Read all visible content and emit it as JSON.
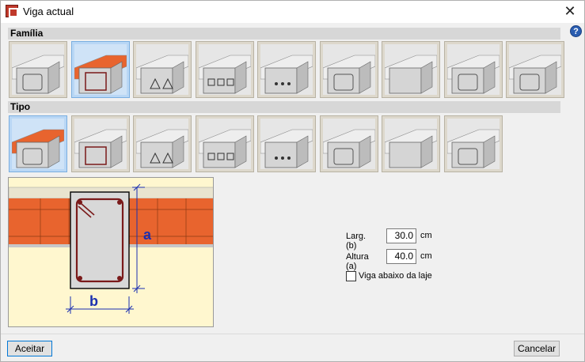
{
  "window": {
    "title": "Viga actual"
  },
  "sections": {
    "familia": "Família",
    "tipo": "Tipo"
  },
  "families": [
    {
      "name": "family-hollow-beam"
    },
    {
      "name": "family-rc-beam-selected"
    },
    {
      "name": "family-prestressed-beam"
    },
    {
      "name": "family-open-web-beam"
    },
    {
      "name": "family-bolted-beam"
    },
    {
      "name": "family-embedded-beam"
    },
    {
      "name": "family-slab-edge"
    },
    {
      "name": "family-steel-beam"
    },
    {
      "name": "family-block-beam"
    }
  ],
  "types": [
    {
      "name": "type-rectangular-selected"
    },
    {
      "name": "type-double-void"
    },
    {
      "name": "type-single-box"
    },
    {
      "name": "type-box-with-flange"
    },
    {
      "name": "type-cross-section"
    },
    {
      "name": "type-t-section"
    },
    {
      "name": "type-double-t-section"
    },
    {
      "name": "type-wide-box"
    }
  ],
  "preview": {
    "label_a": "a",
    "label_b": "b"
  },
  "form": {
    "width_label": "Larg. (b)",
    "width_value": "30.0",
    "width_unit": "cm",
    "height_label": "Altura (a)",
    "height_value": "40.0",
    "height_unit": "cm",
    "below_slab_label": "Viga abaixo da laje",
    "below_slab_checked": false
  },
  "buttons": {
    "accept": "Aceitar",
    "cancel": "Cancelar"
  },
  "help": {
    "glyph": "?"
  },
  "close": {
    "glyph": "✕"
  },
  "colors": {
    "selection": "#b9d7f5",
    "brick": "#e8642e",
    "preview_bg": "#fff7cf",
    "rebar": "#7a1a1a",
    "dimension": "#1a2fb0"
  }
}
